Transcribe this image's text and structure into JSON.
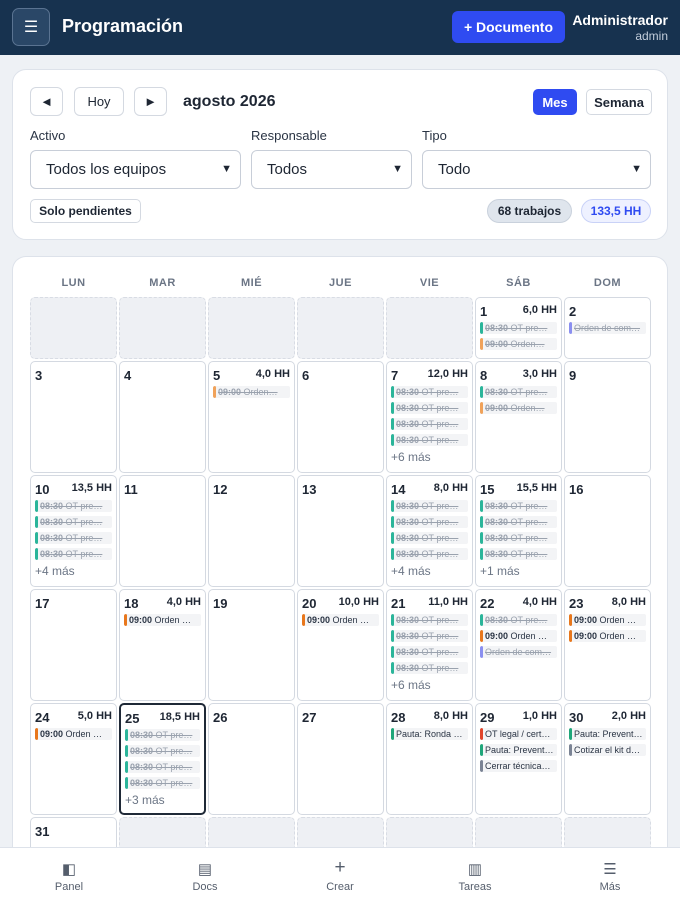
{
  "header": {
    "menu_icon": "hamburger-icon",
    "title": "Programación",
    "new_doc": "+ Documento",
    "user_name": "Administrador",
    "user_role": "admin"
  },
  "toolbar": {
    "prev": "◄",
    "today": "Hoy",
    "next": "►",
    "month": "agosto 2026",
    "view_month": "Mes",
    "view_week": "Semana",
    "active_view": "Mes"
  },
  "filters": {
    "asset_label": "Activo",
    "asset_value": "Todos los equipos",
    "owner_label": "Responsable",
    "owner_value": "Todos",
    "type_label": "Tipo",
    "type_value": "Todo",
    "pending_btn": "Solo pendientes",
    "jobs_count": "68 trabajos",
    "total_hours": "133,5 HH"
  },
  "calendar": {
    "weekdays": [
      "LUN",
      "MAR",
      "MIÉ",
      "JUE",
      "VIE",
      "SÁB",
      "DOM"
    ],
    "days": [
      {
        "day": "1",
        "hh": "6,0 HH",
        "events": [
          {
            "text": "08:30 OT pre…",
            "done": true,
            "color": "#2bb59a"
          },
          {
            "text": "09:00 Orden…",
            "done": true,
            "color": "#f0a25a"
          }
        ]
      },
      {
        "day": "2",
        "hh": "",
        "events": [
          {
            "text": "Orden de com…",
            "done": true,
            "color": "#8a8ff0"
          }
        ]
      },
      {
        "day": "3",
        "hh": "",
        "events": []
      },
      {
        "day": "4",
        "hh": "",
        "events": []
      },
      {
        "day": "5",
        "hh": "4,0 HH",
        "events": [
          {
            "text": "09:00 Orden…",
            "done": true,
            "color": "#f0a25a"
          }
        ]
      },
      {
        "day": "6",
        "hh": "",
        "events": []
      },
      {
        "day": "7",
        "hh": "12,0 HH",
        "events": [
          {
            "text": "08:30 OT pre…",
            "done": true,
            "color": "#2bb59a"
          },
          {
            "text": "08:30 OT pre…",
            "done": true,
            "color": "#2bb59a"
          },
          {
            "text": "08:30 OT pre…",
            "done": true,
            "color": "#2bb59a"
          },
          {
            "text": "08:30 OT pre…",
            "done": true,
            "color": "#2bb59a"
          }
        ],
        "more": "+6 más"
      },
      {
        "day": "8",
        "hh": "3,0 HH",
        "events": [
          {
            "text": "08:30 OT pre…",
            "done": true,
            "color": "#2bb59a"
          },
          {
            "text": "09:00 Orden…",
            "done": true,
            "color": "#f0a25a"
          }
        ]
      },
      {
        "day": "9",
        "hh": "",
        "events": []
      },
      {
        "day": "10",
        "hh": "13,5 HH",
        "events": [
          {
            "text": "08:30 OT pre…",
            "done": true,
            "color": "#2bb59a"
          },
          {
            "text": "08:30 OT pre…",
            "done": true,
            "color": "#2bb59a"
          },
          {
            "text": "08:30 OT pre…",
            "done": true,
            "color": "#2bb59a"
          },
          {
            "text": "08:30 OT pre…",
            "done": true,
            "color": "#2bb59a"
          }
        ],
        "more": "+4 más"
      },
      {
        "day": "11",
        "hh": "",
        "events": []
      },
      {
        "day": "12",
        "hh": "",
        "events": []
      },
      {
        "day": "13",
        "hh": "",
        "events": []
      },
      {
        "day": "14",
        "hh": "8,0 HH",
        "events": [
          {
            "text": "08:30 OT pre…",
            "done": true,
            "color": "#2bb59a"
          },
          {
            "text": "08:30 OT pre…",
            "done": true,
            "color": "#2bb59a"
          },
          {
            "text": "08:30 OT pre…",
            "done": true,
            "color": "#2bb59a"
          },
          {
            "text": "08:30 OT pre…",
            "done": true,
            "color": "#2bb59a"
          }
        ],
        "more": "+4 más"
      },
      {
        "day": "15",
        "hh": "15,5 HH",
        "events": [
          {
            "text": "08:30 OT pre…",
            "done": true,
            "color": "#2bb59a"
          },
          {
            "text": "08:30 OT pre…",
            "done": true,
            "color": "#2bb59a"
          },
          {
            "text": "08:30 OT pre…",
            "done": true,
            "color": "#2bb59a"
          },
          {
            "text": "08:30 OT pre…",
            "done": true,
            "color": "#2bb59a"
          }
        ],
        "more": "+1 más"
      },
      {
        "day": "16",
        "hh": "",
        "events": []
      },
      {
        "day": "17",
        "hh": "",
        "events": []
      },
      {
        "day": "18",
        "hh": "4,0 HH",
        "events": [
          {
            "text": "09:00 Orden …",
            "done": false,
            "color": "#e8771c"
          }
        ]
      },
      {
        "day": "19",
        "hh": "",
        "events": []
      },
      {
        "day": "20",
        "hh": "10,0 HH",
        "events": [
          {
            "text": "09:00 Orden …",
            "done": false,
            "color": "#e8771c"
          }
        ]
      },
      {
        "day": "21",
        "hh": "11,0 HH",
        "events": [
          {
            "text": "08:30 OT pre…",
            "done": true,
            "color": "#2bb59a"
          },
          {
            "text": "08:30 OT pre…",
            "done": true,
            "color": "#2bb59a"
          },
          {
            "text": "08:30 OT pre…",
            "done": true,
            "color": "#2bb59a"
          },
          {
            "text": "08:30 OT pre…",
            "done": true,
            "color": "#2bb59a"
          }
        ],
        "more": "+6 más"
      },
      {
        "day": "22",
        "hh": "4,0 HH",
        "events": [
          {
            "text": "08:30 OT pre…",
            "done": true,
            "color": "#2bb59a"
          },
          {
            "text": "09:00 Orden …",
            "done": false,
            "color": "#e8771c"
          },
          {
            "text": "Orden de com…",
            "done": true,
            "color": "#8a8ff0"
          }
        ]
      },
      {
        "day": "23",
        "hh": "8,0 HH",
        "events": [
          {
            "text": "09:00 Orden …",
            "done": false,
            "color": "#e8771c"
          },
          {
            "text": "09:00 Orden …",
            "done": false,
            "color": "#e8771c"
          }
        ]
      },
      {
        "day": "24",
        "hh": "5,0 HH",
        "events": [
          {
            "text": "09:00 Orden …",
            "done": false,
            "color": "#e8771c"
          }
        ]
      },
      {
        "day": "25",
        "hh": "18,5 HH",
        "today": true,
        "events": [
          {
            "text": "08:30 OT pre…",
            "done": true,
            "color": "#2bb59a"
          },
          {
            "text": "08:30 OT pre…",
            "done": true,
            "color": "#2bb59a"
          },
          {
            "text": "08:30 OT pre…",
            "done": true,
            "color": "#2bb59a"
          },
          {
            "text": "08:30 OT pre…",
            "done": true,
            "color": "#2bb59a"
          }
        ],
        "more": "+3 más"
      },
      {
        "day": "26",
        "hh": "",
        "events": []
      },
      {
        "day": "27",
        "hh": "",
        "events": []
      },
      {
        "day": "28",
        "hh": "8,0 HH",
        "events": [
          {
            "text": "Pauta: Ronda …",
            "done": false,
            "color": "#1fa67a"
          }
        ]
      },
      {
        "day": "29",
        "hh": "1,0 HH",
        "events": [
          {
            "text": "OT legal / cert…",
            "done": false,
            "color": "#e0452b"
          },
          {
            "text": "Pauta: Prevent…",
            "done": false,
            "color": "#1fa67a"
          },
          {
            "text": "Cerrar técnica…",
            "done": false,
            "color": "#7a8394"
          }
        ]
      },
      {
        "day": "30",
        "hh": "2,0 HH",
        "events": [
          {
            "text": "Pauta: Prevent…",
            "done": false,
            "color": "#1fa67a"
          },
          {
            "text": "Cotizar el kit d…",
            "done": false,
            "color": "#7a8394"
          }
        ]
      },
      {
        "day": "31",
        "hh": "",
        "events": []
      }
    ]
  },
  "bottom_nav": [
    {
      "label": "Panel",
      "icon": "panel-icon"
    },
    {
      "label": "Docs",
      "icon": "docs-icon"
    },
    {
      "label": "Crear",
      "icon": "plus-icon"
    },
    {
      "label": "Tareas",
      "icon": "tasks-icon"
    },
    {
      "label": "Más",
      "icon": "menu-icon"
    }
  ]
}
